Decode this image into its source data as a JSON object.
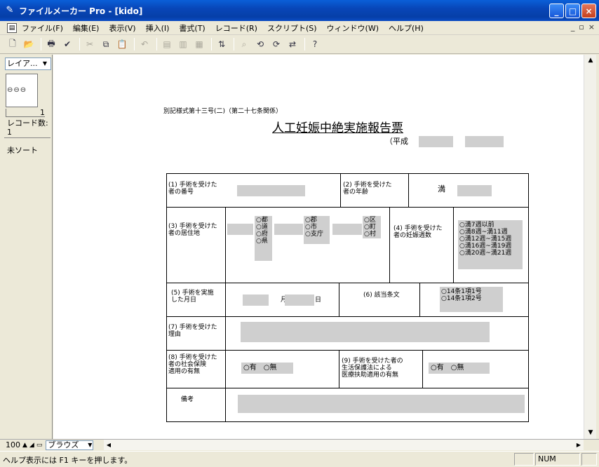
{
  "window": {
    "title": "ファイルメーカー Pro - [kido]"
  },
  "menu": [
    "ファイル(F)",
    "編集(E)",
    "表示(V)",
    "挿入(I)",
    "書式(T)",
    "レコード(R)",
    "スクリプト(S)",
    "ウィンドウ(W)",
    "ヘルプ(H)"
  ],
  "mdi": {
    "min": "_",
    "restore": "▫",
    "close": "×"
  },
  "left_panel": {
    "layout_select": "レイア...",
    "book_page": "1",
    "record_label": "レコード数:",
    "record_count": "1",
    "sort_status": "未ソート"
  },
  "bottom": {
    "zoom": "100",
    "mode": "ブラウズ"
  },
  "status": {
    "help_text": "ヘルプ表示には F1 キーを押します。",
    "num": "NUM"
  },
  "form": {
    "header_ref": "別記様式第十三号(二)（第二十七条関係）",
    "title": "人工妊娠中絶実施報告票",
    "heisei": "（平成",
    "f1": "(1) 手術を受けた\n者の番号",
    "f2": "(2) 手術を受けた\n者の年齢",
    "f2_man": "満",
    "f3": "(3) 手術を受けた\n者の居住地",
    "pref_opts": [
      "都",
      "道",
      "府",
      "県"
    ],
    "city_opts": [
      "郡",
      "市",
      "支庁"
    ],
    "town_opts": [
      "区",
      "町",
      "村"
    ],
    "f4": "(4) 手術を受けた\n者の妊娠週数",
    "weeks": [
      "満7週以前",
      "満8週~満11週",
      "満12週~満15週",
      "満16週~満19週",
      "満20週~満21週"
    ],
    "f5": "(5) 手術を実施\nした月日",
    "month": "月",
    "day": "日",
    "f6": "(6) 該当条文",
    "articles": [
      "14条1項1号",
      "14条1項2号"
    ],
    "f7": "(7) 手術を受けた\n理由",
    "f8": "(8) 手術を受けた\n者の社会保険\n適用の有無",
    "yes": "有",
    "no": "無",
    "f9": "(9) 手術を受けた者の\n生活保護法による\n医療扶助適用の有無",
    "remarks": "備考"
  }
}
